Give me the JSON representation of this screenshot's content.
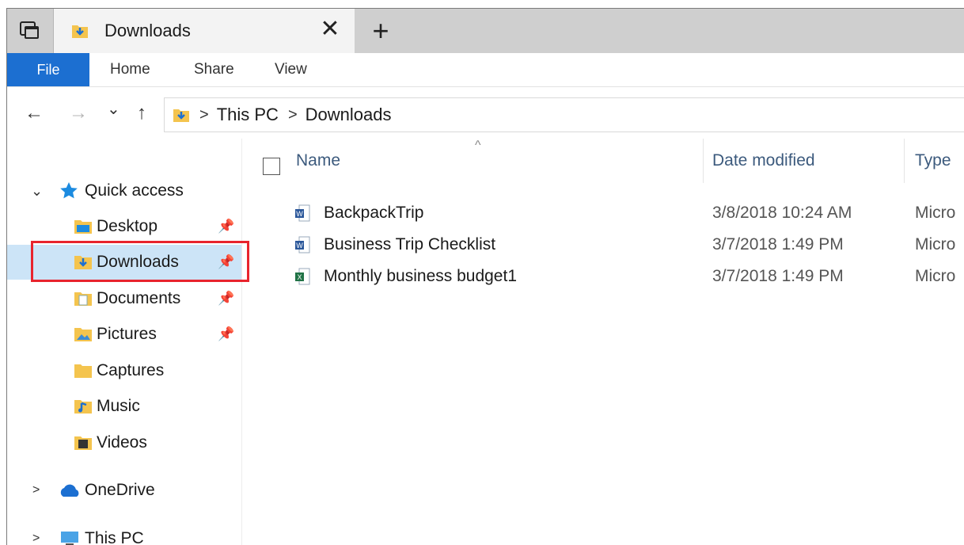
{
  "tab": {
    "title": "Downloads",
    "close": "✕",
    "new_tab": "+"
  },
  "ribbon": {
    "file": "File",
    "home": "Home",
    "share": "Share",
    "view": "View"
  },
  "address": {
    "back": "←",
    "forward": "→",
    "recent": "⌄",
    "up": "↑",
    "crumbs": [
      "This PC",
      "Downloads"
    ],
    "separator": ">"
  },
  "nav": {
    "quick_access": "Quick access",
    "items": [
      {
        "label": "Desktop",
        "icon": "desktop-folder-icon",
        "pinned": true
      },
      {
        "label": "Downloads",
        "icon": "downloads-folder-icon",
        "pinned": true,
        "selected": true
      },
      {
        "label": "Documents",
        "icon": "documents-folder-icon",
        "pinned": true
      },
      {
        "label": "Pictures",
        "icon": "pictures-folder-icon",
        "pinned": true
      },
      {
        "label": "Captures",
        "icon": "folder-icon",
        "pinned": false
      },
      {
        "label": "Music",
        "icon": "music-folder-icon",
        "pinned": false
      },
      {
        "label": "Videos",
        "icon": "videos-folder-icon",
        "pinned": false
      }
    ],
    "onedrive": "OneDrive",
    "this_pc": "This PC",
    "highlight_color": "#e8242d",
    "selected_bg": "#cce4f7"
  },
  "columns": {
    "name": "Name",
    "date": "Date modified",
    "type": "Type",
    "sort_indicator": "^"
  },
  "files": [
    {
      "name": "BackpackTrip",
      "date": "3/8/2018 10:24 AM",
      "type": "Micro",
      "icon": "word-doc-icon"
    },
    {
      "name": "Business Trip Checklist",
      "date": "3/7/2018 1:49 PM",
      "type": "Micro",
      "icon": "word-doc-icon"
    },
    {
      "name": "Monthly business budget1",
      "date": "3/7/2018 1:49 PM",
      "type": "Micro",
      "icon": "excel-doc-icon"
    }
  ],
  "colors": {
    "accent": "#1c6fd1",
    "header_text": "#3c5a7d"
  }
}
